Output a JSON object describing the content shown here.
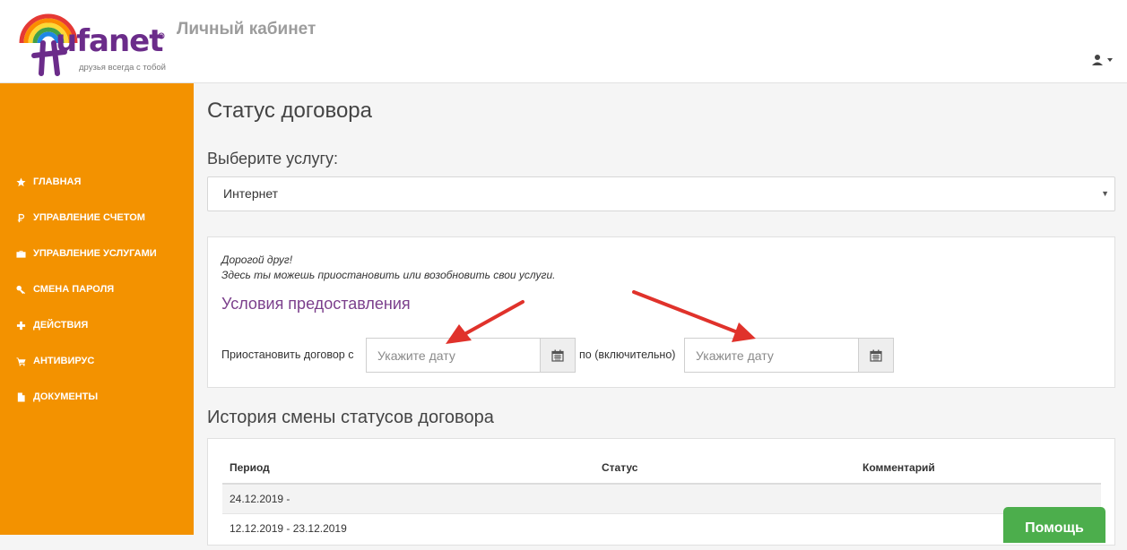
{
  "header": {
    "logo_text": "ufanet",
    "logo_tagline": "друзья всегда с тобой",
    "title": "Личный кабинет"
  },
  "sidebar": {
    "items": [
      {
        "label": "Главная",
        "icon": "star-icon"
      },
      {
        "label": "Управление счетом",
        "icon": "ruble-icon"
      },
      {
        "label": "Управление услугами",
        "icon": "briefcase-icon"
      },
      {
        "label": "Смена пароля",
        "icon": "key-icon"
      },
      {
        "label": "Действия",
        "icon": "plus-icon"
      },
      {
        "label": "Антивирус",
        "icon": "cart-icon"
      },
      {
        "label": "Документы",
        "icon": "document-icon"
      }
    ]
  },
  "main": {
    "page_title": "Статус договора",
    "service_label": "Выберите услугу:",
    "service_selected": "Интернет",
    "intro_line1": "Дорогой друг!",
    "intro_line2": "Здесь ты можешь приостановить или возобновить свои услуги.",
    "conditions_link": "Условия предоставления",
    "suspend_label": "Приостановить договор с",
    "until_label": "по (включительно)",
    "date_from_placeholder": "Укажите дату",
    "date_to_placeholder": "Укажите дату",
    "history_title": "История смены статусов договора",
    "history_columns": [
      "Период",
      "Статус",
      "Комментарий"
    ],
    "history_rows": [
      {
        "period": "24.12.2019 -"
      },
      {
        "period": "12.12.2019 - 23.12.2019"
      }
    ]
  },
  "help_button": "Помощь",
  "colors": {
    "sidebar": "#f39200",
    "link": "#7b3f8c",
    "help": "#4cae4c",
    "arrow": "#e0322b"
  }
}
